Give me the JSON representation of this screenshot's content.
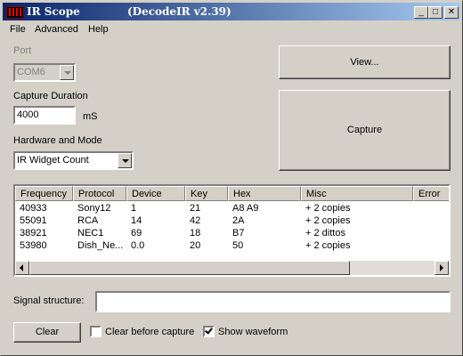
{
  "window": {
    "title": "IR Scope",
    "version": "(DecodeIR v2.39)",
    "controls": {
      "minimize": "_",
      "maximize": "□",
      "close": "✕"
    }
  },
  "menu": [
    "File",
    "Advanced",
    "Help"
  ],
  "port": {
    "label": "Port",
    "value": "COM6"
  },
  "capture_duration": {
    "label": "Capture Duration",
    "value": "4000",
    "unit": "mS"
  },
  "hardware": {
    "label": "Hardware and Mode",
    "value": "IR Widget Count"
  },
  "buttons": {
    "view": "View...",
    "capture": "Capture",
    "clear": "Clear"
  },
  "table": {
    "columns": [
      "Frequency",
      "Protocol",
      "Device",
      "Key",
      "Hex",
      "Misc",
      "Error"
    ],
    "rows": [
      [
        "40933",
        "Sony12",
        "1",
        "21",
        "A8 A9",
        "+ 2 copies",
        ""
      ],
      [
        "55091",
        "RCA",
        "14",
        "42",
        "2A",
        "+ 2 copies",
        ""
      ],
      [
        "38921",
        "NEC1",
        "69",
        "18",
        "B7",
        "+ 2 dittos",
        ""
      ],
      [
        "53980",
        "Dish_Ne...",
        "0.0",
        "20",
        "50",
        "+ 2 copies",
        ""
      ]
    ]
  },
  "signal_structure": {
    "label": "Signal structure:",
    "value": ""
  },
  "options": {
    "clear_before_capture": {
      "label": "Clear before capture",
      "checked": false
    },
    "show_waveform": {
      "label": "Show waveform",
      "checked": true
    }
  }
}
